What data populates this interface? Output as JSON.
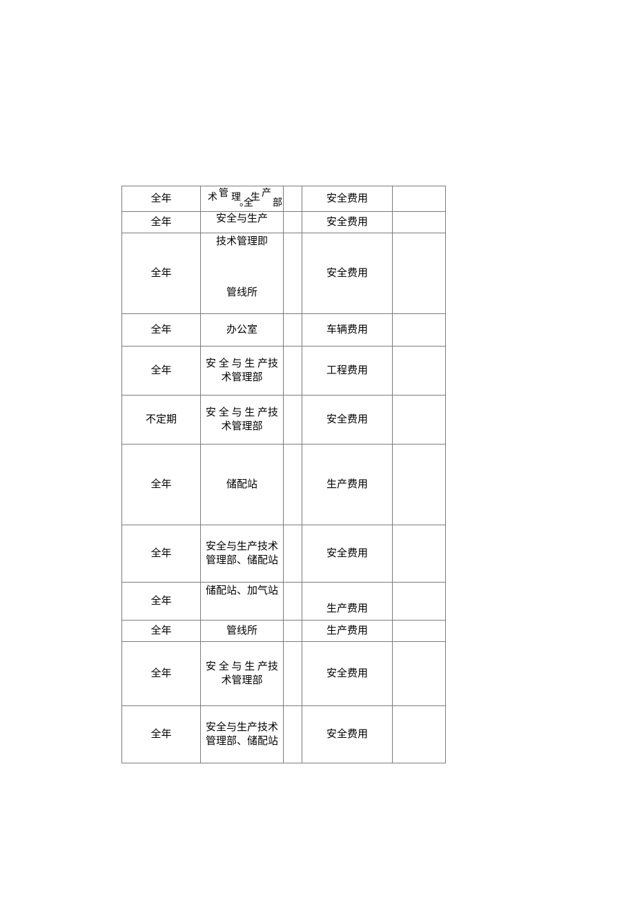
{
  "rows": [
    {
      "c1": "全年",
      "c2_chars": [
        "术",
        "管",
        "理",
        "全",
        "。",
        "生",
        "产",
        "部"
      ],
      "c4": "安全费用"
    },
    {
      "c1": "全年",
      "c2": "安全与生产",
      "c4": "安全费用"
    },
    {
      "c1": "全年",
      "c2_top": "技术管理即",
      "c2_bot": "管线所",
      "c4": "安全费用"
    },
    {
      "c1": "全年",
      "c2": "办公室",
      "c4": "车辆费用"
    },
    {
      "c1": "全年",
      "c2": "安 全 与 生 产技术管理部",
      "c4": "工程费用"
    },
    {
      "c1": "不定期",
      "c2": "安 全 与 生 产技术管理部",
      "c4": "安全费用"
    },
    {
      "c1": "全年",
      "c2": "储配站",
      "c4": "生产费用"
    },
    {
      "c1": "全年",
      "c2": "安全与生产技术管理部、储配站",
      "c4": "安全费用"
    },
    {
      "c1": "全年",
      "c2": "储配站、加气站",
      "c4": "生产费用"
    },
    {
      "c1": "全年",
      "c2": "管线所",
      "c4": "生产费用"
    },
    {
      "c1": "全年",
      "c2": "安 全 与 生 产技术管理部",
      "c4": "安全费用"
    },
    {
      "c1": "全年",
      "c2": "安全与生产技术管理部、储配站",
      "c4": "安全费用"
    }
  ]
}
